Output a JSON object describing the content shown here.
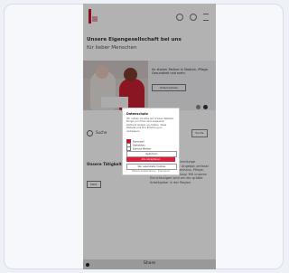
{
  "page": {
    "heading": "Unsere Eigengesellschaft bei uns",
    "subheading": "für lieber Menschen",
    "hero": {
      "text": "Ihr starker Partner in Medizin, Pflege, Gesundheit und mehr",
      "button_label": "Unternehmen"
    },
    "search": {
      "label": "Suche",
      "button_label": "Suche"
    },
    "section": {
      "left_title": "Unsere Tätigkeitsfelder",
      "left_button": "Mehr",
      "right_text": "Wir sind eine gemeinnützige Gesellschaft. Unser Angebot umfasst die Bereiche Krankenhaus, Pflege, Betreuung und Bildung. Mit unseren Einrichtungen sind wir der größte Arbeitgeber in der Region."
    },
    "footer": {
      "label": "Share"
    }
  },
  "cookie_modal": {
    "title": "Datenschutz",
    "text": "Wir nutzen Cookies auf unserer Website. Einige von ihnen sind essenziell, während andere uns helfen, diese Website und Ihre Erfahrung zu verbessern.",
    "options": [
      "Essenziell",
      "Statistiken",
      "Externe Medien"
    ],
    "accept_selected": "Speichern",
    "accept_all": "Alle akzeptieren",
    "decline": "Nur essenzielle Cookies",
    "links": "Datenschutzerklärung · Impressum"
  },
  "colors": {
    "brand": "#c0182b",
    "accent_button": "#d91f3b"
  }
}
